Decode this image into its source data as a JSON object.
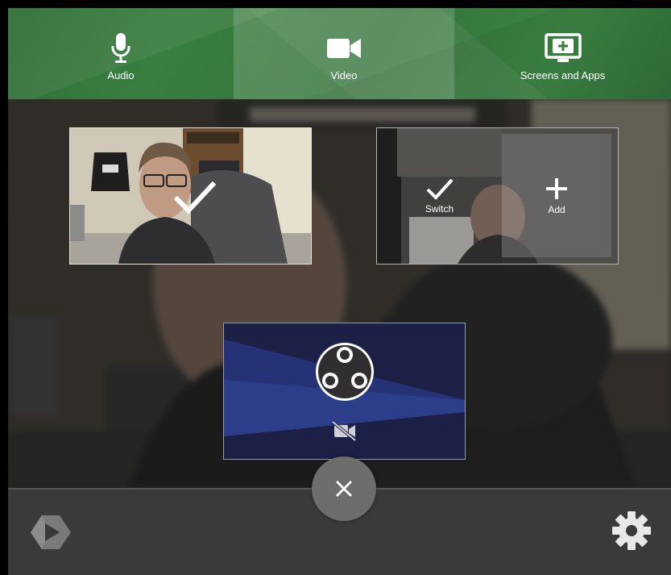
{
  "tabs": [
    {
      "id": "audio",
      "label": "Audio",
      "icon": "microphone-icon"
    },
    {
      "id": "video",
      "label": "Video",
      "icon": "video-camera-icon",
      "selected": true
    },
    {
      "id": "screens",
      "label": "Screens and Apps",
      "icon": "screen-add-icon"
    }
  ],
  "sources": {
    "camera_1": {
      "state": "selected",
      "icon": "checkmark-icon"
    },
    "camera_2": {
      "switch_label": "Switch",
      "add_label": "Add",
      "switch_icon": "checkmark-icon",
      "add_icon": "plus-icon"
    },
    "obs_virtual_camera": {
      "logo": "obs-logo-icon",
      "status_icon": "camera-off-icon"
    }
  },
  "bottom_bar": {
    "close_icon": "close-icon",
    "logo_icon": "panopto-logo-icon",
    "settings_icon": "gear-icon"
  },
  "colors": {
    "accent_green": "#3a7e41",
    "bottom_bar": "#3a3a3a",
    "close_button": "#6d6d6d",
    "obs_tile_bg": "#1a1f45"
  }
}
